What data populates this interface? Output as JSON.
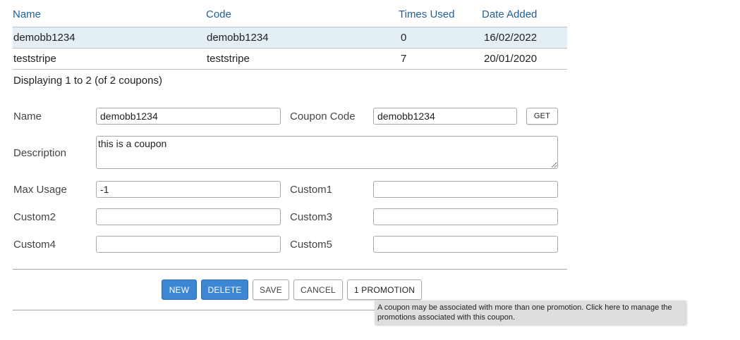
{
  "table": {
    "headers": [
      "Name",
      "Code",
      "Times Used",
      "Date Added"
    ],
    "rows": [
      {
        "name": "demobb1234",
        "code": "demobb1234",
        "times_used": "0",
        "date_added": "16/02/2022"
      },
      {
        "name": "teststripe",
        "code": "teststripe",
        "times_used": "7",
        "date_added": "20/01/2020"
      }
    ],
    "selected_row": 0
  },
  "displaying": "Displaying 1 to 2 (of 2 coupons)",
  "form": {
    "name_label": "Name",
    "name_value": "demobb1234",
    "coupon_code_label": "Coupon Code",
    "coupon_code_value": "demobb1234",
    "get_label": "GET",
    "description_label": "Description",
    "description_value": "this is a coupon",
    "max_usage_label": "Max Usage",
    "max_usage_value": "-1",
    "custom1_label": "Custom1",
    "custom1_value": "",
    "custom2_label": "Custom2",
    "custom2_value": "",
    "custom3_label": "Custom3",
    "custom3_value": "",
    "custom4_label": "Custom4",
    "custom4_value": "",
    "custom5_label": "Custom5",
    "custom5_value": ""
  },
  "actions": {
    "new_label": "NEW",
    "delete_label": "DELETE",
    "save_label": "SAVE",
    "cancel_label": "CANCEL",
    "promotion_label": "1 PROMOTION"
  },
  "tooltip": "A coupon may be associated with more than one promotion.  Click here to manage the promotions associated with this coupon.",
  "colors": {
    "header_text": "#1f5f97",
    "selected_row": "#e4eef5",
    "primary_button": "#3d86d4",
    "tooltip_bg": "#dedede"
  }
}
